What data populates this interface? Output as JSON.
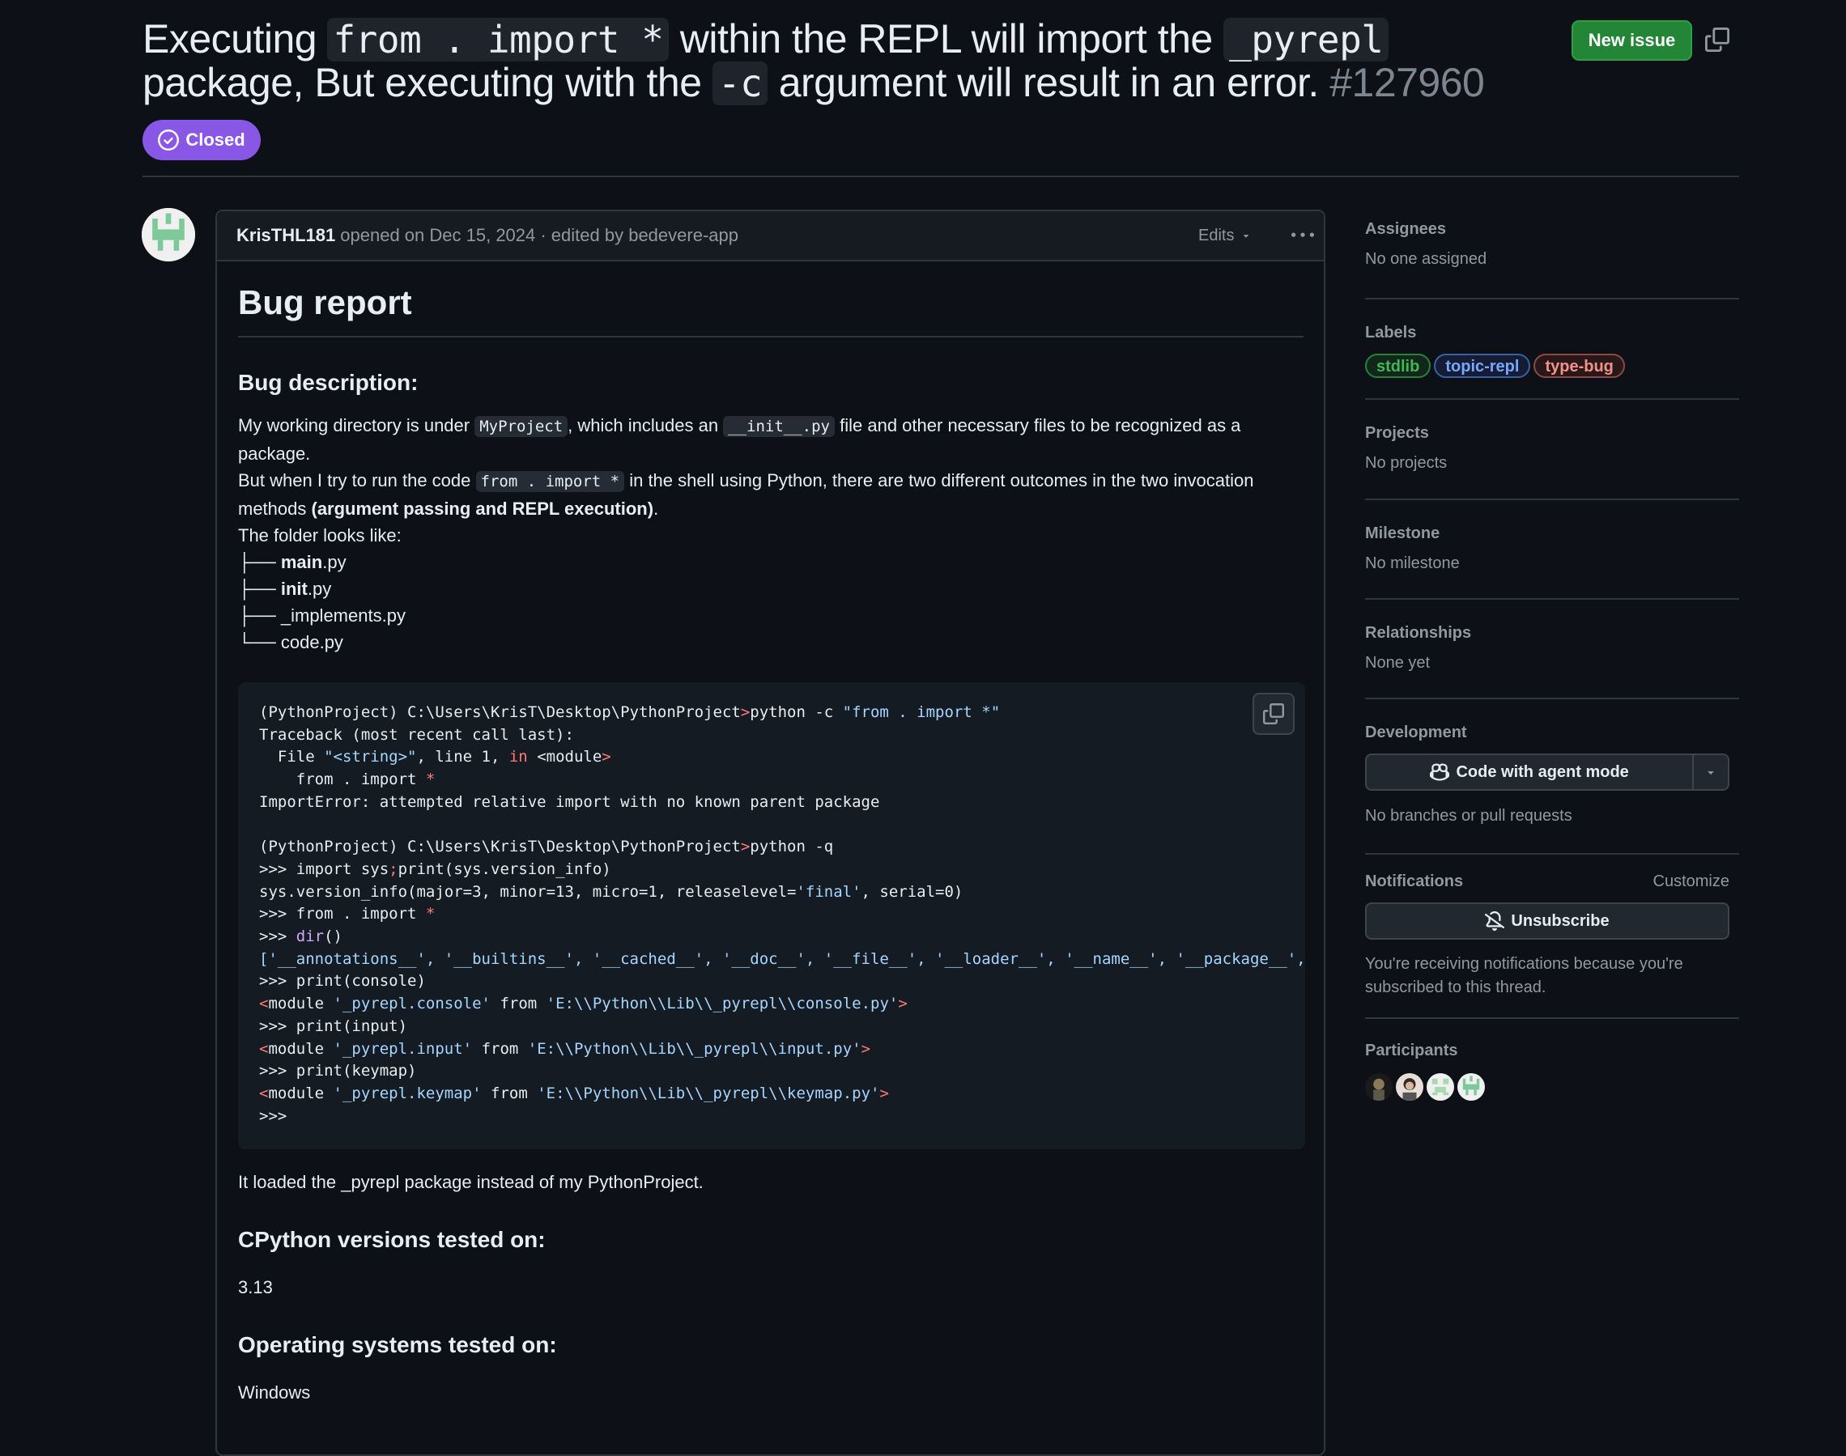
{
  "issue": {
    "title_parts": {
      "t1": "Executing ",
      "c1": "from . import *",
      "t2": " within the REPL will import the ",
      "c2": "_pyrepl",
      "t3": " package, But executing with the ",
      "c3": "-c",
      "t4": " argument will result in an error. ",
      "number": "#127960"
    },
    "state": "Closed",
    "new_issue_label": "New issue"
  },
  "comment": {
    "author": "KrisTHL181",
    "meta": "opened on Dec 15, 2024 · edited by bedevere-app",
    "edits_label": "Edits",
    "heading": "Bug report",
    "bug_description_heading": "Bug description:",
    "p1_a": "My working directory is under ",
    "p1_code1": "MyProject",
    "p1_b": ", which includes an ",
    "p1_code2": "__init__.py",
    "p1_c": " file and other necessary files to be recognized as a package.",
    "p2_a": "But when I try to run the code ",
    "p2_code": "from . import *",
    "p2_b": " in the shell using Python, there are two different outcomes in the two invocation methods ",
    "p2_bold": "(argument passing and REPL execution)",
    "p2_c": ".",
    "p3": "The folder looks like:",
    "tree": [
      {
        "prefix": "├── ",
        "bold": "main",
        "rest": ".py"
      },
      {
        "prefix": "├── ",
        "bold": "init",
        "rest": ".py"
      },
      {
        "prefix": "├── ",
        "bold": "",
        "rest": "_implements.py"
      },
      {
        "prefix": "└── ",
        "bold": "",
        "rest": "code.py"
      }
    ],
    "after_code": "It loaded the _pyrepl package instead of my PythonProject.",
    "versions_heading": "CPython versions tested on:",
    "versions_value": "3.13",
    "os_heading": "Operating systems tested on:",
    "os_value": "Windows"
  },
  "code": {
    "l1a": "(PythonProject) C:\\Users\\KrisT\\Desktop\\PythonProject",
    "l1b": ">",
    "l1c": "python -c ",
    "l1d": "\"from . import *\"",
    "l2": "Traceback (most recent call last):",
    "l3a": "  File ",
    "l3b": "\"<string>\"",
    "l3c": ", line 1, ",
    "l3d": "in",
    "l3e": " <",
    "l3f": "module",
    "l3g": ">",
    "l4a": "    from . import ",
    "l4b": "*",
    "l5": "ImportError: attempted relative import with no known parent package",
    "l7a": "(PythonProject) C:\\Users\\KrisT\\Desktop\\PythonProject",
    "l7b": ">",
    "l7c": "python -q",
    "l8a": ">>> import sys",
    "l8b": ";",
    "l8c": "print(sys.version_info)",
    "l9a": "sys.version_info(major=3, minor=13, micro=1, releaselevel=",
    "l9b": "'final'",
    "l9c": ", serial=0)",
    "l10a": ">>> from . import ",
    "l10b": "*",
    "l11a": ">>> ",
    "l11b": "dir",
    "l11c": "()",
    "l12": "['__annotations__', '__builtins__', '__cached__', '__doc__', '__file__', '__loader__', '__name__', '__package__', '__spec__', 'console', 'input', 'keymap']",
    "l13": ">>> print(console)",
    "l14a": "<",
    "l14b": "module ",
    "l14c": "'_pyrepl.console'",
    "l14d": " from ",
    "l14e": "'E:\\\\Python\\\\Lib\\\\_pyrepl\\\\console.py'",
    "l14f": ">",
    "l15": ">>> print(input)",
    "l16c": "'_pyrepl.input'",
    "l16e": "'E:\\\\Python\\\\Lib\\\\_pyrepl\\\\input.py'",
    "l17": ">>> print(keymap)",
    "l18c": "'_pyrepl.keymap'",
    "l18e": "'E:\\\\Python\\\\Lib\\\\_pyrepl\\\\keymap.py'",
    "l19": ">>>"
  },
  "sidebar": {
    "assignees_title": "Assignees",
    "assignees_value": "No one assigned",
    "labels_title": "Labels",
    "labels": [
      {
        "name": "stdlib",
        "color": "#3fb950"
      },
      {
        "name": "topic-repl",
        "color": "#79a6ff"
      },
      {
        "name": "type-bug",
        "color": "#f0938a"
      }
    ],
    "projects_title": "Projects",
    "projects_value": "No projects",
    "milestone_title": "Milestone",
    "milestone_value": "No milestone",
    "relationships_title": "Relationships",
    "relationships_value": "None yet",
    "development_title": "Development",
    "agent_button": "Code with agent mode",
    "development_value": "No branches or pull requests",
    "notifications_title": "Notifications",
    "customize_label": "Customize",
    "unsubscribe_label": "Unsubscribe",
    "notifications_note": "You're receiving notifications because you're subscribed to this thread.",
    "participants_title": "Participants"
  }
}
